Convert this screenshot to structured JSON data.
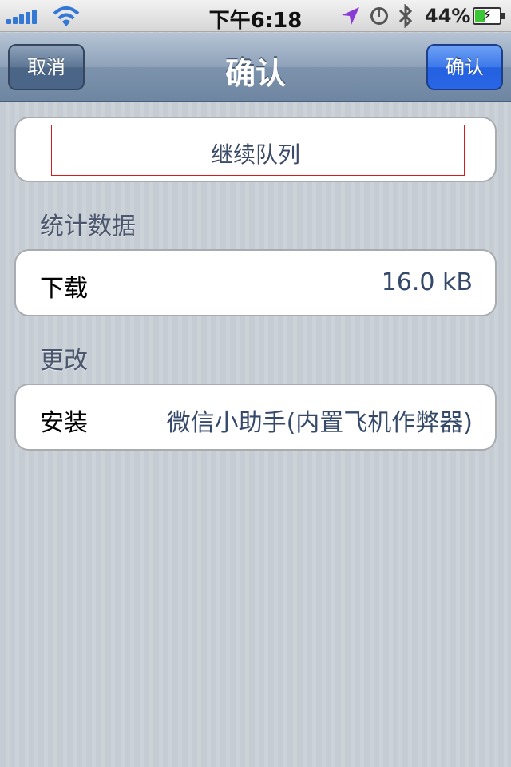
{
  "status_bar": {
    "time": "下午6:18",
    "battery_percent": "44%",
    "battery_level": 0.44,
    "icons": [
      "signal-icon",
      "wifi-icon",
      "location-icon",
      "clock-icon",
      "bluetooth-icon",
      "battery-icon"
    ]
  },
  "nav": {
    "title": "确认",
    "cancel_label": "取消",
    "confirm_label": "确认",
    "colors": {
      "confirm_button": "#2a66e6",
      "nav_bar": "#7d93ad"
    }
  },
  "queue": {
    "label": "继续队列"
  },
  "stats": {
    "header": "统计数据",
    "rows": [
      {
        "label": "下载",
        "value": "16.0 kB"
      }
    ]
  },
  "changes": {
    "header": "更改",
    "rows": [
      {
        "label": "安装",
        "value": "微信小助手(内置飞机作弊器)"
      }
    ]
  }
}
